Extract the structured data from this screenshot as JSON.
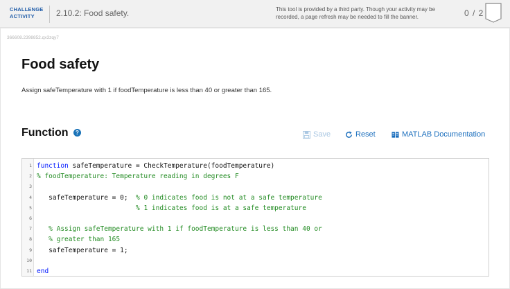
{
  "banner": {
    "challenge_label": "CHALLENGE ACTIVITY",
    "activity_title": "2.10.2: Food safety.",
    "third_party_note": "This tool is provided by a third party. Though your activity may be recorded, a page refresh may be needed to fill the banner.",
    "score": "0 / 2"
  },
  "activity_id": "366608.2398852.qx3zqy7",
  "content": {
    "title": "Food safety",
    "description": "Assign safeTemperature with 1 if foodTemperature is less than 40 or greater than 165."
  },
  "function_section": {
    "heading": "Function",
    "help_icon": "question-circle-icon",
    "save_label": "Save",
    "reset_label": "Reset",
    "docs_label": "MATLAB Documentation",
    "colors": {
      "link": "#1a6ebd",
      "disabled": "#a9c7e2"
    }
  },
  "editor": {
    "lines": [
      {
        "num": "1",
        "kw": "function",
        "text": " safeTemperature = CheckTemperature(foodTemperature)",
        "comment": ""
      },
      {
        "num": "2",
        "kw": "",
        "text": "",
        "comment": "% foodTemperature: Temperature reading in degrees F"
      },
      {
        "num": "3",
        "kw": "",
        "text": "",
        "comment": ""
      },
      {
        "num": "4",
        "kw": "",
        "text": "   safeTemperature = 0;  ",
        "comment": "% 0 indicates food is not at a safe temperature"
      },
      {
        "num": "5",
        "kw": "",
        "text": "                         ",
        "comment": "% 1 indicates food is at a safe temperature"
      },
      {
        "num": "6",
        "kw": "",
        "text": "",
        "comment": ""
      },
      {
        "num": "7",
        "kw": "",
        "text": "   ",
        "comment": "% Assign safeTemperature with 1 if foodTemperature is less than 40 or"
      },
      {
        "num": "8",
        "kw": "",
        "text": "   ",
        "comment": "% greater than 165"
      },
      {
        "num": "9",
        "kw": "",
        "text": "   safeTemperature = 1;",
        "comment": ""
      },
      {
        "num": "10",
        "kw": "",
        "text": "",
        "comment": ""
      },
      {
        "num": "11",
        "kw": "end",
        "text": "",
        "comment": ""
      }
    ]
  }
}
